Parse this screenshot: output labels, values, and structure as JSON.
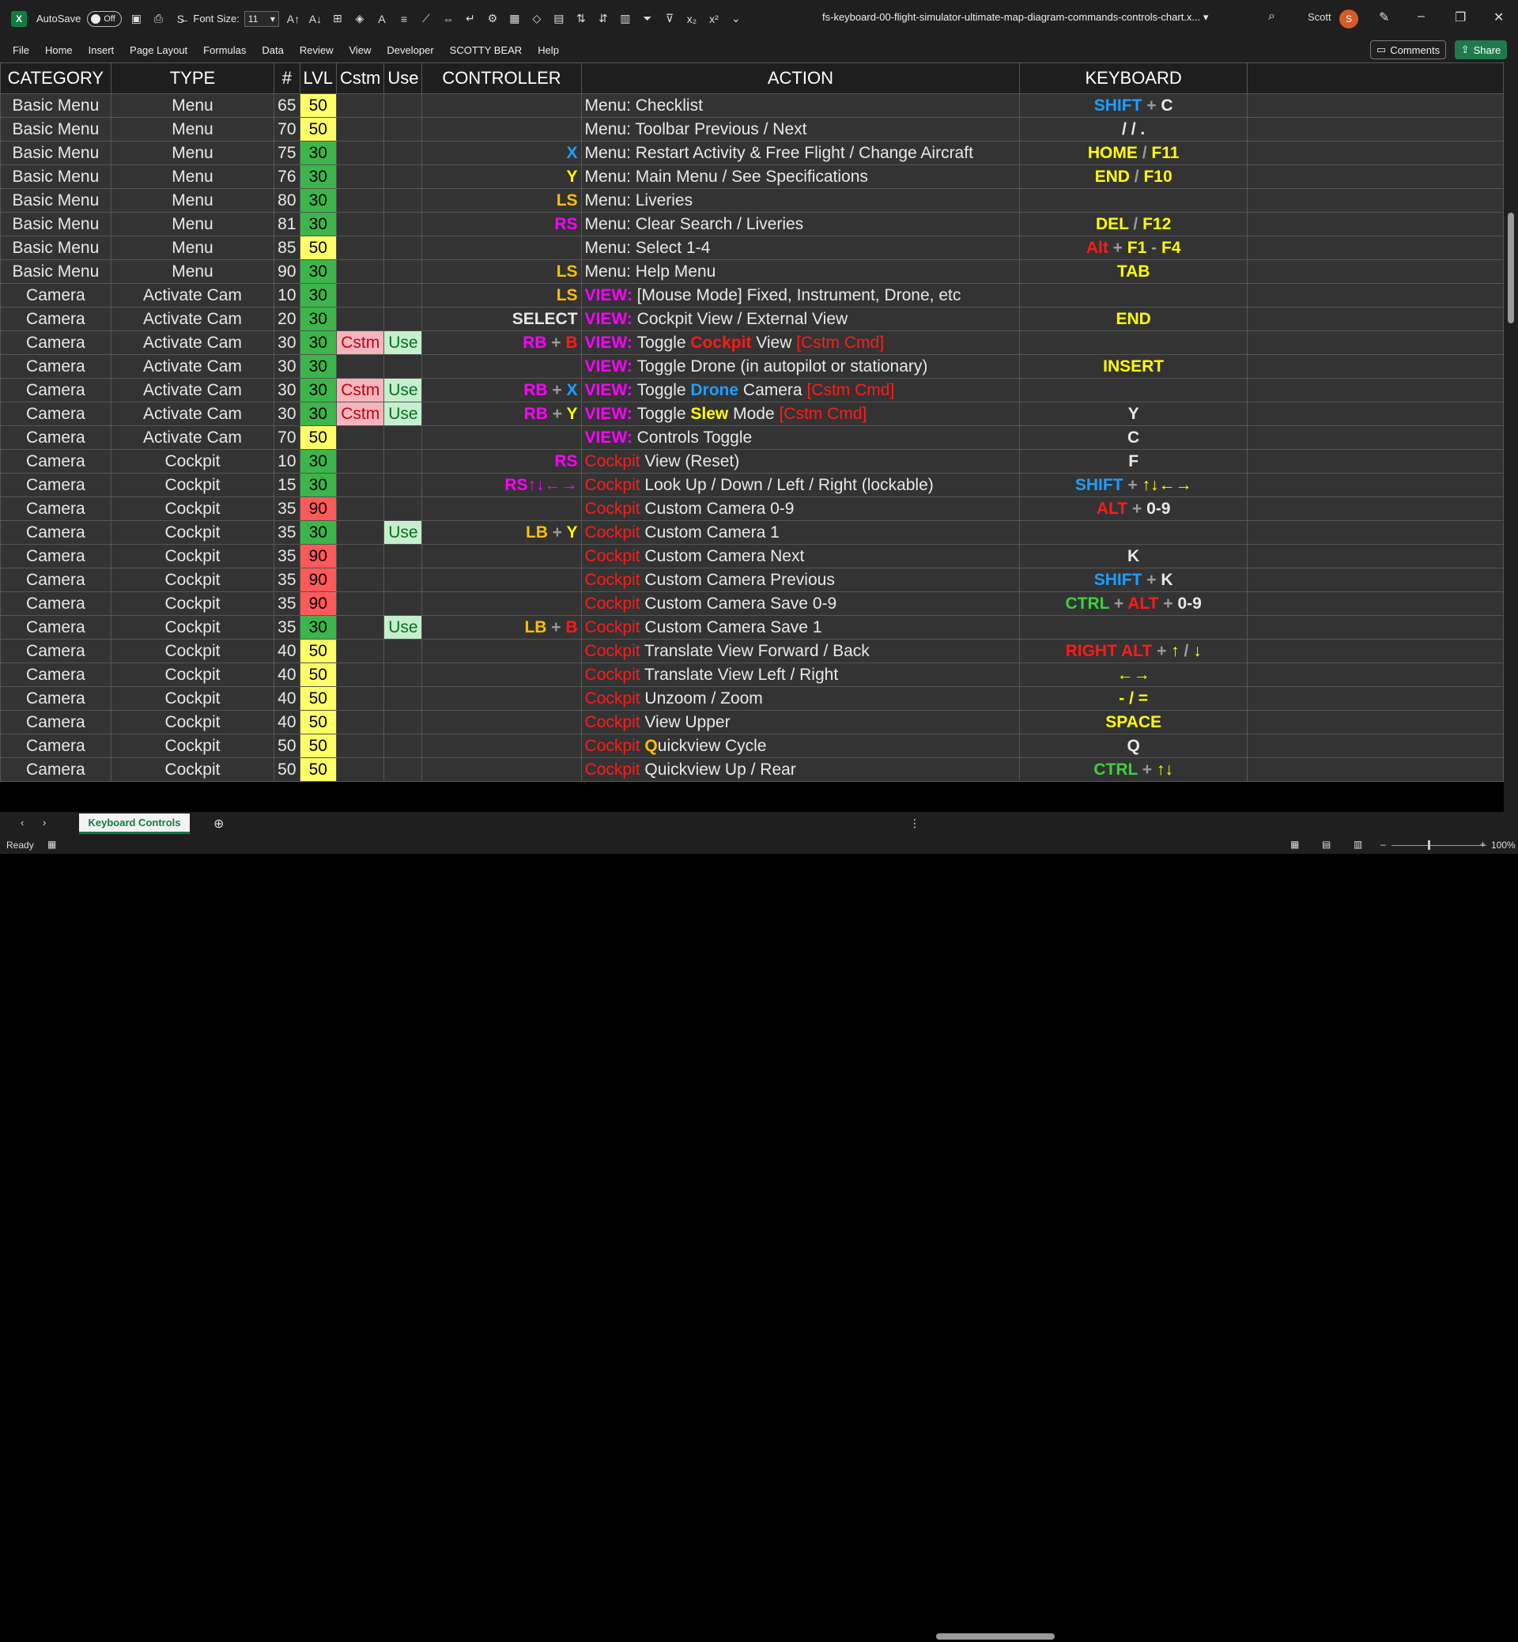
{
  "titlebar": {
    "autosave_label": "AutoSave",
    "autosave_state": "Off",
    "font_size_label": "Font Size:",
    "font_size_value": "11",
    "file_name": "fs-keyboard-00-flight-simulator-ultimate-map-diagram-commands-controls-chart.x...",
    "user_name": "Scott",
    "user_initial": "S"
  },
  "menu": [
    "File",
    "Home",
    "Insert",
    "Page Layout",
    "Formulas",
    "Data",
    "Review",
    "View",
    "Developer",
    "SCOTTY BEAR",
    "Help"
  ],
  "buttons": {
    "comments": "Comments",
    "share": "Share"
  },
  "headers": {
    "category": "CATEGORY",
    "type": "TYPE",
    "num": "#",
    "lvl": "LVL",
    "cstm": "Cstm",
    "use": "Use",
    "controller": "CONTROLLER",
    "action": "ACTION",
    "keyboard": "KEYBOARD"
  },
  "colors": {
    "lvl_30": "#3cb54a",
    "lvl_50": "#ffff66",
    "lvl_90": "#ff5a5a"
  },
  "rows": [
    {
      "cat": "Basic Menu",
      "type": "Menu",
      "num": "65",
      "lvl": "50",
      "cstm": "",
      "use": "",
      "ctrl": [],
      "act": [
        [
          "w",
          "Menu: Checklist"
        ]
      ],
      "kb": [
        [
          "b",
          "SHIFT"
        ],
        [
          "gy",
          " + "
        ],
        [
          "w",
          "C"
        ]
      ]
    },
    {
      "cat": "Basic Menu",
      "type": "Menu",
      "num": "70",
      "lvl": "50",
      "cstm": "",
      "use": "",
      "ctrl": [],
      "act": [
        [
          "w",
          "Menu: Toolbar Previous / Next"
        ]
      ],
      "kb": [
        [
          "w",
          "/ / ."
        ]
      ]
    },
    {
      "cat": "Basic Menu",
      "type": "Menu",
      "num": "75",
      "lvl": "30",
      "cstm": "",
      "use": "",
      "ctrl": [
        [
          "b",
          "X"
        ]
      ],
      "act": [
        [
          "w",
          "Menu: Restart Activity & Free Flight / Change Aircraft"
        ]
      ],
      "kb": [
        [
          "y",
          "HOME"
        ],
        [
          "gy",
          " / "
        ],
        [
          "y",
          "F11"
        ]
      ]
    },
    {
      "cat": "Basic Menu",
      "type": "Menu",
      "num": "76",
      "lvl": "30",
      "cstm": "",
      "use": "",
      "ctrl": [
        [
          "y",
          "Y"
        ]
      ],
      "act": [
        [
          "w",
          "Menu: Main Menu / See Specifications"
        ]
      ],
      "kb": [
        [
          "y",
          "END"
        ],
        [
          "gy",
          " / "
        ],
        [
          "y",
          "F10"
        ]
      ]
    },
    {
      "cat": "Basic Menu",
      "type": "Menu",
      "num": "80",
      "lvl": "30",
      "cstm": "",
      "use": "",
      "ctrl": [
        [
          "o",
          "LS"
        ]
      ],
      "act": [
        [
          "w",
          "Menu: Liveries"
        ]
      ],
      "kb": []
    },
    {
      "cat": "Basic Menu",
      "type": "Menu",
      "num": "81",
      "lvl": "30",
      "cstm": "",
      "use": "",
      "ctrl": [
        [
          "pk",
          "RS"
        ]
      ],
      "act": [
        [
          "w",
          "Menu: Clear Search / Liveries"
        ]
      ],
      "kb": [
        [
          "y",
          "DEL"
        ],
        [
          "gy",
          " / "
        ],
        [
          "y",
          "F12"
        ]
      ]
    },
    {
      "cat": "Basic Menu",
      "type": "Menu",
      "num": "85",
      "lvl": "50",
      "cstm": "",
      "use": "",
      "ctrl": [],
      "act": [
        [
          "w",
          "Menu: Select 1-4"
        ]
      ],
      "kb": [
        [
          "rs",
          "Alt"
        ],
        [
          "gy",
          " + "
        ],
        [
          "y",
          "F1"
        ],
        [
          "gy",
          " - "
        ],
        [
          "y",
          "F4"
        ]
      ]
    },
    {
      "cat": "Basic Menu",
      "type": "Menu",
      "num": "90",
      "lvl": "30",
      "cstm": "",
      "use": "",
      "ctrl": [
        [
          "o",
          "LS"
        ]
      ],
      "act": [
        [
          "w",
          "Menu: Help Menu"
        ]
      ],
      "kb": [
        [
          "y",
          "TAB"
        ]
      ]
    },
    {
      "cat": "Camera",
      "type": "Activate Cam",
      "num": "10",
      "lvl": "30",
      "cstm": "",
      "use": "",
      "ctrl": [
        [
          "o",
          "LS"
        ]
      ],
      "act": [
        [
          "v",
          "VIEW: "
        ],
        [
          "w",
          "[Mouse Mode] Fixed, Instrument, Drone, etc"
        ]
      ],
      "kb": []
    },
    {
      "cat": "Camera",
      "type": "Activate Cam",
      "num": "20",
      "lvl": "30",
      "cstm": "",
      "use": "",
      "ctrl": [
        [
          "w",
          "SELECT"
        ]
      ],
      "act": [
        [
          "v",
          "VIEW: "
        ],
        [
          "w",
          "Cockpit View / External View"
        ]
      ],
      "kb": [
        [
          "y",
          "END"
        ]
      ]
    },
    {
      "cat": "Camera",
      "type": "Activate Cam",
      "num": "30",
      "lvl": "30",
      "cstm": "Cstm",
      "use": "Use",
      "ctrl": [
        [
          "pk",
          "RB"
        ],
        [
          "gy",
          " + "
        ],
        [
          "rs",
          "B"
        ]
      ],
      "act": [
        [
          "v",
          "VIEW: "
        ],
        [
          "w",
          "Toggle "
        ],
        [
          "rs",
          "Cockpit"
        ],
        [
          "w",
          " View "
        ],
        [
          "r",
          "[Cstm Cmd]"
        ]
      ],
      "kb": []
    },
    {
      "cat": "Camera",
      "type": "Activate Cam",
      "num": "30",
      "lvl": "30",
      "cstm": "",
      "use": "",
      "ctrl": [],
      "act": [
        [
          "v",
          "VIEW: "
        ],
        [
          "w",
          "Toggle Drone (in autopilot or stationary)"
        ]
      ],
      "kb": [
        [
          "y",
          "INSERT"
        ]
      ]
    },
    {
      "cat": "Camera",
      "type": "Activate Cam",
      "num": "30",
      "lvl": "30",
      "cstm": "Cstm",
      "use": "Use",
      "ctrl": [
        [
          "pk",
          "RB"
        ],
        [
          "gy",
          " + "
        ],
        [
          "b",
          "X"
        ]
      ],
      "act": [
        [
          "v",
          "VIEW: "
        ],
        [
          "w",
          "Toggle "
        ],
        [
          "b",
          "Drone"
        ],
        [
          "w",
          " Camera  "
        ],
        [
          "r",
          "[Cstm Cmd]"
        ]
      ],
      "kb": []
    },
    {
      "cat": "Camera",
      "type": "Activate Cam",
      "num": "30",
      "lvl": "30",
      "cstm": "Cstm",
      "use": "Use",
      "ctrl": [
        [
          "pk",
          "RB"
        ],
        [
          "gy",
          " + "
        ],
        [
          "y",
          "Y"
        ]
      ],
      "act": [
        [
          "v",
          "VIEW: "
        ],
        [
          "w",
          "Toggle "
        ],
        [
          "y",
          "Slew"
        ],
        [
          "w",
          " Mode "
        ],
        [
          "r",
          "[Cstm Cmd]"
        ]
      ],
      "kb": [
        [
          "w",
          "Y"
        ]
      ]
    },
    {
      "cat": "Camera",
      "type": "Activate Cam",
      "num": "70",
      "lvl": "50",
      "cstm": "",
      "use": "",
      "ctrl": [],
      "act": [
        [
          "v",
          "VIEW: "
        ],
        [
          "w",
          "Controls Toggle"
        ]
      ],
      "kb": [
        [
          "w",
          "C"
        ]
      ]
    },
    {
      "cat": "Camera",
      "type": "Cockpit",
      "num": "10",
      "lvl": "30",
      "cstm": "",
      "use": "",
      "ctrl": [
        [
          "pk",
          "RS"
        ]
      ],
      "act": [
        [
          "r",
          "Cockpit"
        ],
        [
          "w",
          " View (Reset)"
        ]
      ],
      "kb": [
        [
          "w",
          "F"
        ]
      ]
    },
    {
      "cat": "Camera",
      "type": "Cockpit",
      "num": "15",
      "lvl": "30",
      "cstm": "",
      "use": "",
      "ctrl": [
        [
          "pk",
          "RS↑↓←→"
        ]
      ],
      "act": [
        [
          "r",
          "Cockpit"
        ],
        [
          "w",
          " Look Up / Down / Left / Right (lockable)"
        ]
      ],
      "kb": [
        [
          "b",
          "SHIFT"
        ],
        [
          "gy",
          " + "
        ],
        [
          "y",
          "↑↓←→"
        ]
      ]
    },
    {
      "cat": "Camera",
      "type": "Cockpit",
      "num": "35",
      "lvl": "90",
      "cstm": "",
      "use": "",
      "ctrl": [],
      "act": [
        [
          "r",
          "Cockpit"
        ],
        [
          "w",
          " Custom Camera 0-9"
        ]
      ],
      "kb": [
        [
          "rs",
          "ALT"
        ],
        [
          "gy",
          " + "
        ],
        [
          "w",
          "0-9"
        ]
      ]
    },
    {
      "cat": "Camera",
      "type": "Cockpit",
      "num": "35",
      "lvl": "30",
      "cstm": "",
      "use": "Use",
      "ctrl": [
        [
          "o",
          "LB"
        ],
        [
          "gy",
          " + "
        ],
        [
          "y",
          "Y"
        ]
      ],
      "act": [
        [
          "r",
          "Cockpit"
        ],
        [
          "w",
          " Custom Camera 1"
        ]
      ],
      "kb": []
    },
    {
      "cat": "Camera",
      "type": "Cockpit",
      "num": "35",
      "lvl": "90",
      "cstm": "",
      "use": "",
      "ctrl": [],
      "act": [
        [
          "r",
          "Cockpit"
        ],
        [
          "w",
          " Custom Camera Next"
        ]
      ],
      "kb": [
        [
          "w",
          "K"
        ]
      ]
    },
    {
      "cat": "Camera",
      "type": "Cockpit",
      "num": "35",
      "lvl": "90",
      "cstm": "",
      "use": "",
      "ctrl": [],
      "act": [
        [
          "r",
          "Cockpit"
        ],
        [
          "w",
          " Custom Camera Previous"
        ]
      ],
      "kb": [
        [
          "b",
          "SHIFT"
        ],
        [
          "gy",
          " + "
        ],
        [
          "w",
          "K"
        ]
      ]
    },
    {
      "cat": "Camera",
      "type": "Cockpit",
      "num": "35",
      "lvl": "90",
      "cstm": "",
      "use": "",
      "ctrl": [],
      "act": [
        [
          "r",
          "Cockpit"
        ],
        [
          "w",
          " Custom Camera Save 0-9"
        ]
      ],
      "kb": [
        [
          "g",
          "CTRL"
        ],
        [
          "gy",
          " + "
        ],
        [
          "rs",
          "ALT"
        ],
        [
          "gy",
          " + "
        ],
        [
          "w",
          "0-9"
        ]
      ]
    },
    {
      "cat": "Camera",
      "type": "Cockpit",
      "num": "35",
      "lvl": "30",
      "cstm": "",
      "use": "Use",
      "ctrl": [
        [
          "o",
          "LB"
        ],
        [
          "gy",
          " + "
        ],
        [
          "rs",
          "B"
        ]
      ],
      "act": [
        [
          "r",
          "Cockpit"
        ],
        [
          "w",
          " Custom Camera Save 1"
        ]
      ],
      "kb": []
    },
    {
      "cat": "Camera",
      "type": "Cockpit",
      "num": "40",
      "lvl": "50",
      "cstm": "",
      "use": "",
      "ctrl": [],
      "act": [
        [
          "r",
          "Cockpit"
        ],
        [
          "w",
          " Translate View Forward / Back"
        ]
      ],
      "kb": [
        [
          "rs",
          "RIGHT ALT"
        ],
        [
          "gy",
          " + "
        ],
        [
          "y",
          "↑"
        ],
        [
          "gy",
          " / "
        ],
        [
          "y",
          "↓"
        ]
      ]
    },
    {
      "cat": "Camera",
      "type": "Cockpit",
      "num": "40",
      "lvl": "50",
      "cstm": "",
      "use": "",
      "ctrl": [],
      "act": [
        [
          "r",
          "Cockpit"
        ],
        [
          "w",
          " Translate View Left / Right"
        ]
      ],
      "kb": [
        [
          "y",
          "←→"
        ]
      ]
    },
    {
      "cat": "Camera",
      "type": "Cockpit",
      "num": "40",
      "lvl": "50",
      "cstm": "",
      "use": "",
      "ctrl": [],
      "act": [
        [
          "r",
          "Cockpit"
        ],
        [
          "w",
          " Unzoom / Zoom"
        ]
      ],
      "kb": [
        [
          "y",
          "- / ="
        ]
      ]
    },
    {
      "cat": "Camera",
      "type": "Cockpit",
      "num": "40",
      "lvl": "50",
      "cstm": "",
      "use": "",
      "ctrl": [],
      "act": [
        [
          "r",
          "Cockpit"
        ],
        [
          "w",
          " View Upper"
        ]
      ],
      "kb": [
        [
          "y",
          "SPACE"
        ]
      ]
    },
    {
      "cat": "Camera",
      "type": "Cockpit",
      "num": "50",
      "lvl": "50",
      "cstm": "",
      "use": "",
      "ctrl": [],
      "act": [
        [
          "r",
          "Cockpit"
        ],
        [
          "w",
          " "
        ],
        [
          "o",
          "Q"
        ],
        [
          "w",
          "uickview Cycle"
        ]
      ],
      "kb": [
        [
          "w",
          "Q"
        ]
      ]
    },
    {
      "cat": "Camera",
      "type": "Cockpit",
      "num": "50",
      "lvl": "50",
      "cstm": "",
      "use": "",
      "ctrl": [],
      "act": [
        [
          "r",
          "Cockpit"
        ],
        [
          "w",
          " Quickview Up / Rear"
        ]
      ],
      "kb": [
        [
          "g",
          "CTRL"
        ],
        [
          "gy",
          " + "
        ],
        [
          "y",
          "↑↓"
        ]
      ]
    }
  ],
  "sheet_tab": "Keyboard Controls",
  "status": {
    "ready": "Ready",
    "zoom": "100%"
  }
}
